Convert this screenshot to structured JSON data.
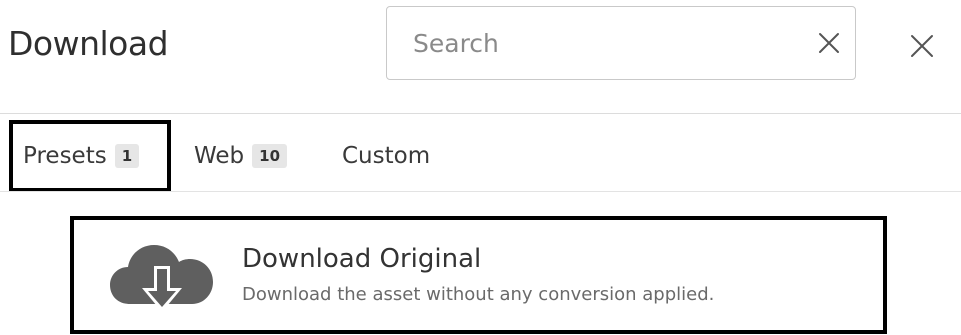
{
  "header": {
    "title": "Download",
    "search": {
      "placeholder": "Search",
      "value": "",
      "clear_icon": "close-icon"
    },
    "close_icon": "close-icon"
  },
  "tabs": [
    {
      "label": "Presets",
      "count": "1",
      "active": true
    },
    {
      "label": "Web",
      "count": "10",
      "active": false
    },
    {
      "label": "Custom",
      "count": "",
      "active": false
    }
  ],
  "presets": [
    {
      "icon": "cloud-download-icon",
      "title": "Download Original",
      "description": "Download the asset without any conversion applied."
    }
  ],
  "colors": {
    "icon_gray": "#5f5f5f",
    "badge_bg": "#e6e6e6",
    "highlight_border": "#000000"
  }
}
